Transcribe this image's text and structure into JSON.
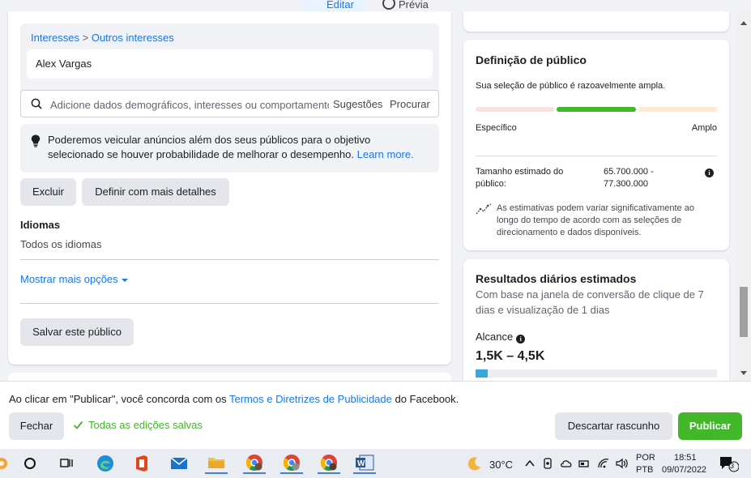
{
  "top_tabs": {
    "edit": "Editar",
    "preview": "Prévia"
  },
  "interests": {
    "breadcrumb_root": "Interesses",
    "breadcrumb_sep": ">",
    "breadcrumb_child": "Outros interesses",
    "selected": "Alex Vargas"
  },
  "search": {
    "placeholder": "Adicione dados demográficos, interesses ou comportamentos",
    "suggestions": "Sugestões",
    "browse": "Procurar"
  },
  "notice": {
    "text": "Poderemos veicular anúncios além dos seus públicos para o objetivo selecionado se houver probabilidade de melhorar o desempenho.",
    "link": "Learn more."
  },
  "buttons": {
    "exclude": "Excluir",
    "narrow": "Definir com mais detalhes",
    "save_audience": "Salvar este público"
  },
  "languages": {
    "label": "Idiomas",
    "value": "Todos os idiomas"
  },
  "more_options": "Mostrar mais opções",
  "audience_definition": {
    "title": "Definição de público",
    "description": "Sua seleção de público é razoavelmente ampla.",
    "specific": "Específico",
    "broad": "Amplo",
    "size_label": "Tamanho estimado do público:",
    "size_value": "65.700.000 - 77.300.000",
    "note": "As estimativas podem variar significativamente ao longo do tempo de acordo com as seleções de direcionamento e dados disponíveis."
  },
  "daily_results": {
    "title": "Resultados diários estimados",
    "description": "Com base na janela de conversão de clique de 7 dias e visualização de 1 dias",
    "reach_label": "Alcance",
    "reach_value": "1,5K – 4,5K",
    "reach_fill_fraction": 0.05
  },
  "footer": {
    "legal_prefix": "Ao clicar em \"Publicar\", você concorda com os ",
    "legal_link": "Termos e Diretrizes de Publicidade",
    "legal_suffix": " do Facebook.",
    "close": "Fechar",
    "saved": "Todas as edições salvas",
    "discard": "Descartar rascunho",
    "publish": "Publicar"
  },
  "taskbar": {
    "temperature": "30°C",
    "lang_line1": "POR",
    "lang_line2": "PTB",
    "time": "18:51",
    "date": "09/07/2022",
    "notifications": "3"
  },
  "colors": {
    "accent": "#1877f2",
    "success": "#42b72a",
    "reach": "#34a9e0"
  }
}
